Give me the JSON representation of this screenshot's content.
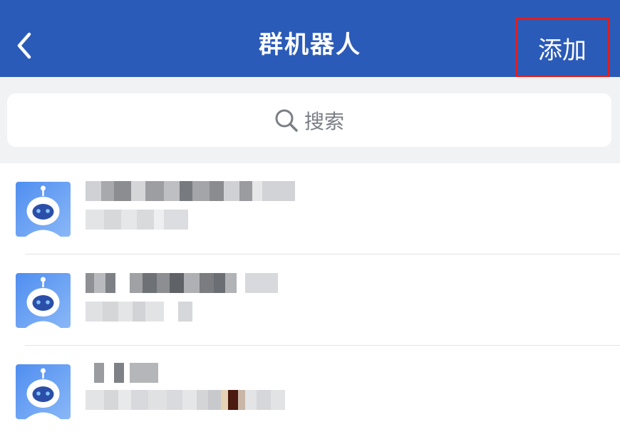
{
  "header": {
    "title": "群机器人",
    "add_label": "添加",
    "bg_color": "#2b5bb8",
    "highlight_color": "#e11d1d",
    "back_icon": "chevron-left-icon"
  },
  "search": {
    "placeholder": "搜索",
    "icon": "search-icon"
  },
  "list": {
    "item_count": 3,
    "avatar_icon": "robot-icon",
    "avatar_color": "#5a96f0"
  }
}
